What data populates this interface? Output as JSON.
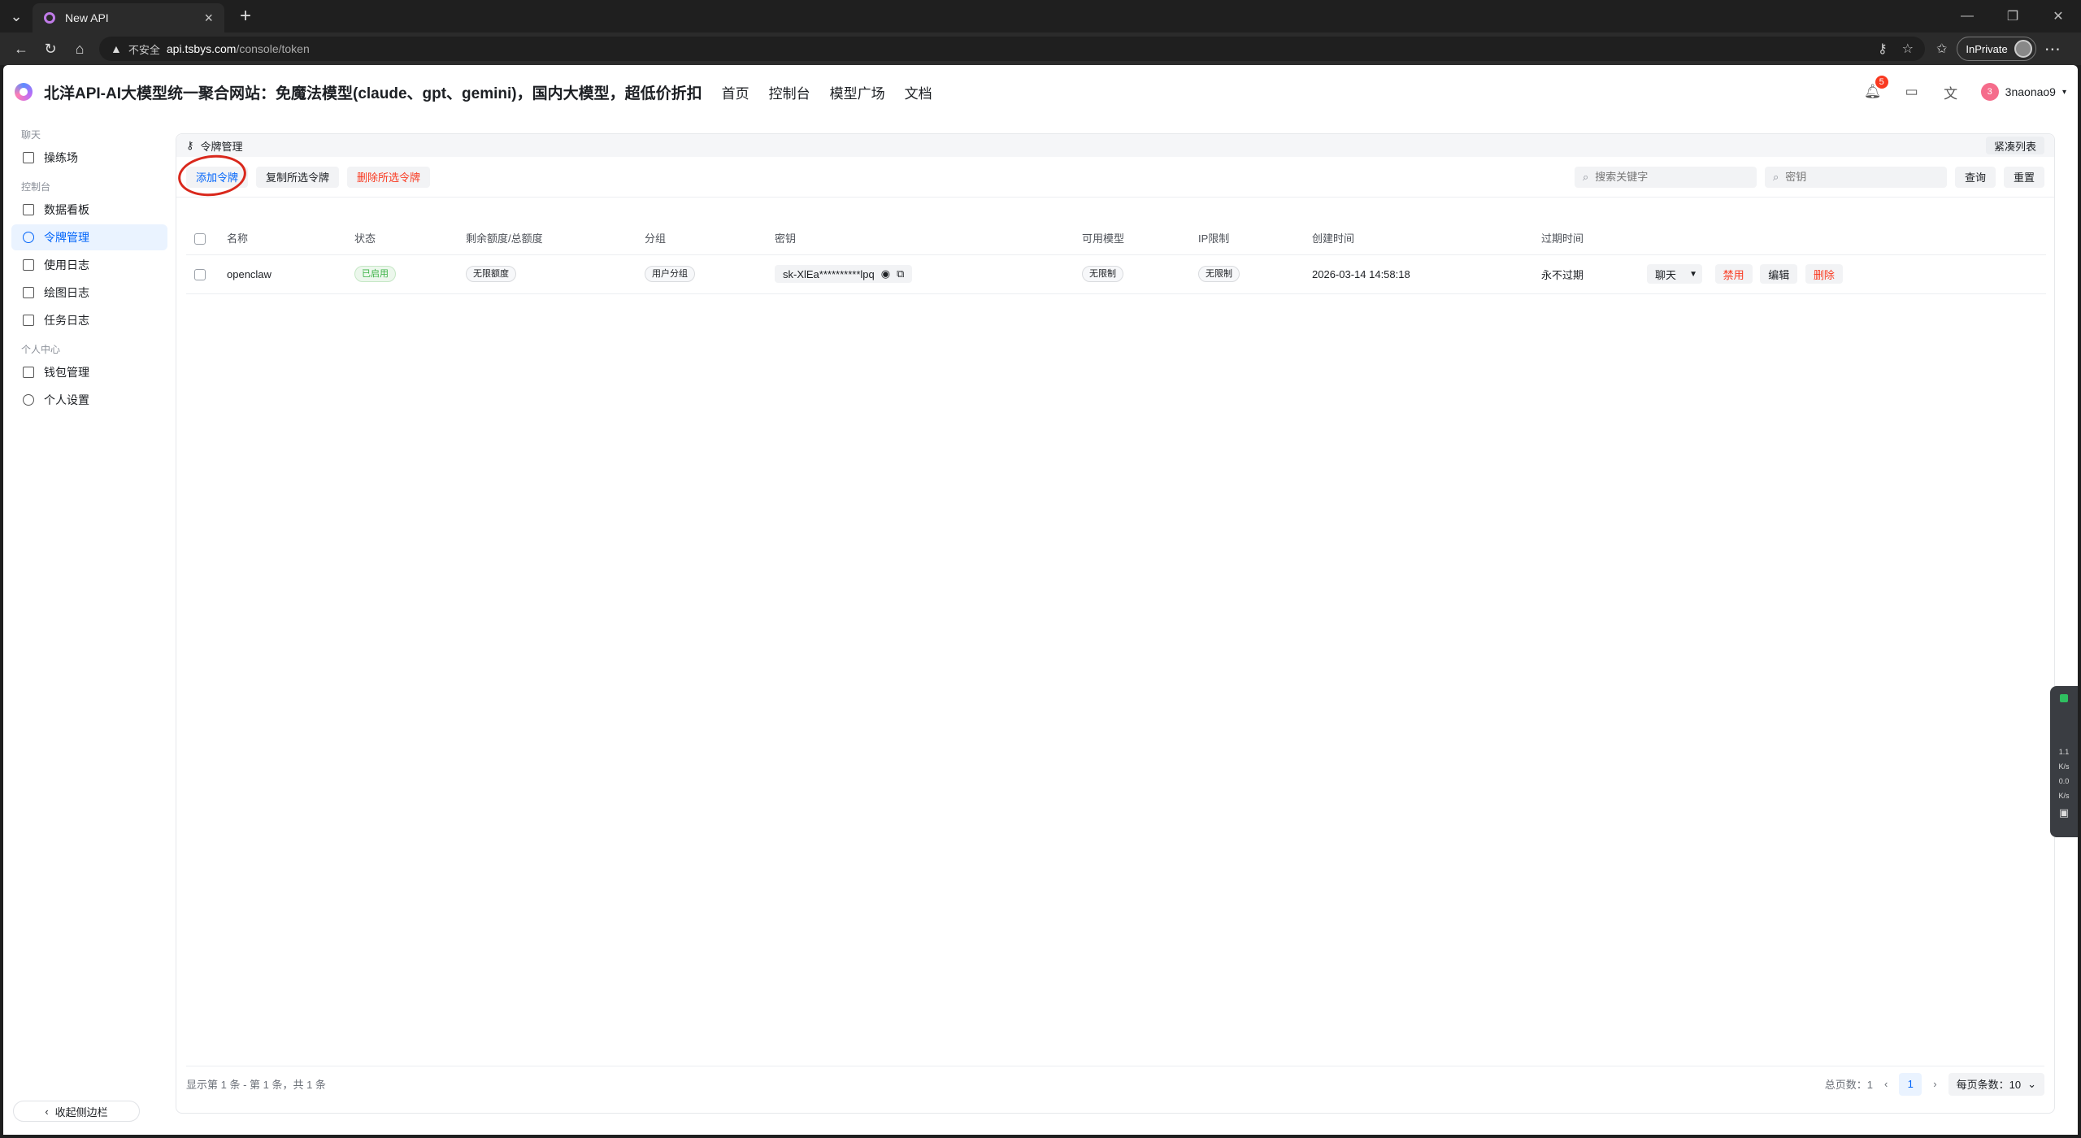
{
  "browser": {
    "tab_title": "New API",
    "url_insecure": "不安全",
    "url_host": "api.tsbys.com",
    "url_path": "/console/token",
    "inprivate_label": "InPrivate"
  },
  "header": {
    "title": "北洋API-AI大模型统一聚合网站：免魔法模型(claude、gpt、gemini)，国内大模型，超低价折扣",
    "nav": [
      "首页",
      "控制台",
      "模型广场",
      "文档"
    ],
    "notification_count": "5",
    "user_initial": "3",
    "username": "3naonao9"
  },
  "sidebar": {
    "groups": [
      {
        "label": "聊天",
        "items": [
          "操练场"
        ]
      },
      {
        "label": "控制台",
        "items": [
          "数据看板",
          "令牌管理",
          "使用日志",
          "绘图日志",
          "任务日志"
        ]
      },
      {
        "label": "个人中心",
        "items": [
          "钱包管理",
          "个人设置"
        ]
      }
    ],
    "active": "令牌管理",
    "collapse_label": "收起侧边栏"
  },
  "card": {
    "title": "令牌管理",
    "compact_label": "紧凑列表",
    "toolbar": {
      "add": "添加令牌",
      "copy_selected": "复制所选令牌",
      "delete_selected": "删除所选令牌",
      "search_placeholder": "搜索关键字",
      "key_placeholder": "密钥",
      "query": "查询",
      "reset": "重置"
    },
    "columns": [
      "名称",
      "状态",
      "剩余额度/总额度",
      "分组",
      "密钥",
      "可用模型",
      "IP限制",
      "创建时间",
      "过期时间"
    ],
    "rows": [
      {
        "name": "openclaw",
        "status": "已启用",
        "quota": "无限额度",
        "group": "用户分组",
        "key": "sk-XlEa**********lpq",
        "models": "无限制",
        "ip": "无限制",
        "created": "2026-03-14 14:58:18",
        "expires": "永不过期",
        "ops": {
          "chat": "聊天",
          "disable": "禁用",
          "edit": "编辑",
          "delete": "删除"
        }
      }
    ],
    "footer": {
      "summary": "显示第 1 条 - 第 1 条，共 1 条",
      "total_pages": "总页数：1",
      "current_page": "1",
      "page_size": "每页条数：10"
    }
  },
  "widget": {
    "line1": "1.1",
    "line2": "K/s",
    "line3": "0.0",
    "line4": "K/s"
  },
  "colors": {
    "accent": "#0064fa",
    "danger": "#f93920",
    "success": "#3bb346",
    "highlight": "#d9281c"
  }
}
